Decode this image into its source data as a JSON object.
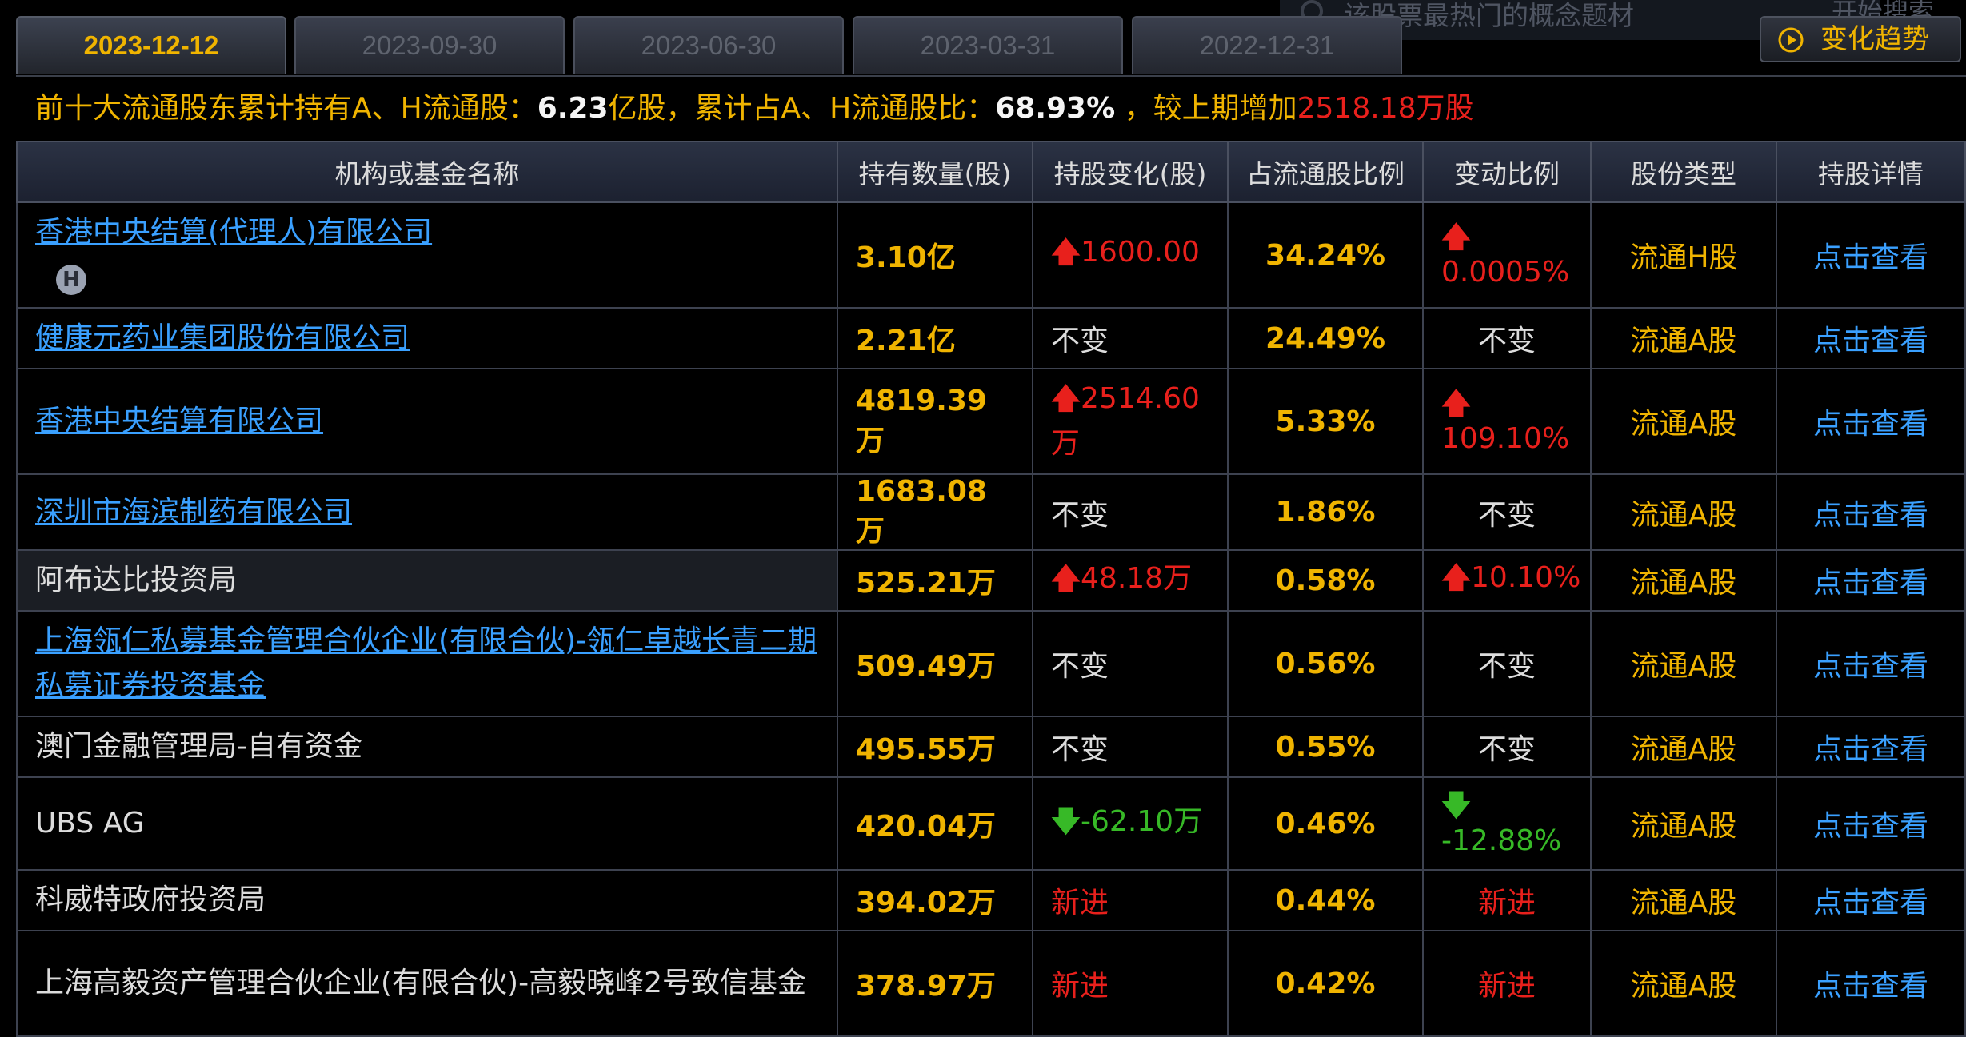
{
  "tabs": [
    {
      "label": "2023-12-12",
      "active": true
    },
    {
      "label": "2023-09-30"
    },
    {
      "label": "2023-06-30"
    },
    {
      "label": "2023-03-31"
    },
    {
      "label": "2022-12-31"
    }
  ],
  "search": {
    "placeholder": "该股票最热门的概念题材",
    "button": "开始搜索"
  },
  "trend_button": "变化趋势",
  "summary": {
    "prefix": "前十大流通股东累计持有A、H流通股：",
    "shares": "6.23",
    "unit1": "亿股，累计占A、H流通股比：",
    "ratio": "68.93%",
    "mid": " ，较上期增加",
    "increase": "2518.18万股"
  },
  "table": {
    "headers": [
      "机构或基金名称",
      "持有数量(股)",
      "持股变化(股)",
      "占流通股比例",
      "变动比例",
      "股份类型",
      "持股详情"
    ],
    "rows": [
      {
        "name": "香港中央结算(代理人)有限公司",
        "badge": "H",
        "qty": "3.10亿",
        "chg": "1600.00",
        "pct": "34.24%",
        "ratio": "0.0005%",
        "type": "流通H股",
        "detail": "点击查看"
      },
      {
        "name": "健康元药业集团股份有限公司",
        "qty": "2.21亿",
        "chg": "不变",
        "pct": "24.49%",
        "ratio": "不变",
        "type": "流通A股",
        "detail": "点击查看"
      },
      {
        "name": "香港中央结算有限公司",
        "qty": "4819.39万",
        "chg": "2514.60万",
        "pct": "5.33%",
        "ratio": "109.10%",
        "type": "流通A股",
        "detail": "点击查看"
      },
      {
        "name": "深圳市海滨制药有限公司",
        "qty": "1683.08万",
        "chg": "不变",
        "pct": "1.86%",
        "ratio": "不变",
        "type": "流通A股",
        "detail": "点击查看"
      },
      {
        "name": "阿布达比投资局",
        "qty": "525.21万",
        "chg": "48.18万",
        "pct": "0.58%",
        "ratio": "10.10%",
        "type": "流通A股",
        "detail": "点击查看"
      },
      {
        "name": "上海瓴仁私募基金管理合伙企业(有限合伙)-瓴仁卓越长青二期私募证券投资基金",
        "qty": "509.49万",
        "chg": "不变",
        "pct": "0.56%",
        "ratio": "不变",
        "type": "流通A股",
        "detail": "点击查看"
      },
      {
        "name": "澳门金融管理局-自有资金",
        "qty": "495.55万",
        "chg": "不变",
        "pct": "0.55%",
        "ratio": "不变",
        "type": "流通A股",
        "detail": "点击查看"
      },
      {
        "name": "UBS AG",
        "qty": "420.04万",
        "chg": "-62.10万",
        "pct": "0.46%",
        "ratio": "-12.88%",
        "type": "流通A股",
        "detail": "点击查看"
      },
      {
        "name": "科威特政府投资局",
        "qty": "394.02万",
        "chg": "新进",
        "pct": "0.44%",
        "ratio": "新进",
        "type": "流通A股",
        "detail": "点击查看"
      },
      {
        "name": "上海高毅资产管理合伙企业(有限合伙)-高毅晓峰2号致信基金",
        "qty": "378.97万",
        "chg": "新进",
        "pct": "0.42%",
        "ratio": "新进",
        "type": "流通A股",
        "detail": "点击查看"
      }
    ]
  },
  "colors": {
    "accent": "#f0b400",
    "up": "#e8201c",
    "down": "#37b927",
    "link": "#3aa0ff",
    "background": "#000000"
  },
  "icons": {
    "search": "search-icon",
    "trend": "play-circle-icon",
    "up": "arrow-up-icon",
    "down": "arrow-down-icon",
    "badge": "h-share-badge"
  }
}
